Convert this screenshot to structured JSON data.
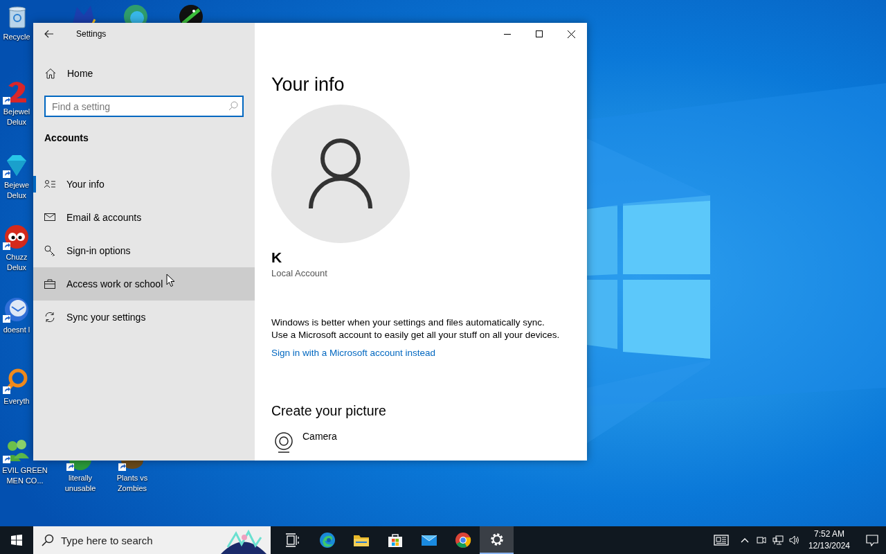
{
  "desktop": {
    "icons": [
      {
        "kind": "recycle",
        "shortcut": false,
        "label": [
          "Recycle"
        ]
      },
      {
        "kind": "badge",
        "shortcut": false
      },
      {
        "kind": "browser",
        "shortcut": false
      },
      {
        "kind": "space",
        "shortcut": false
      },
      {
        "kind": "game",
        "shortcut": true,
        "label": [
          "Bejewel",
          "Delux"
        ]
      },
      {
        "kind": "gem",
        "shortcut": true,
        "label": [
          "Bejewe",
          "Delux"
        ]
      },
      {
        "kind": "creature",
        "shortcut": true,
        "label": [
          "Chuzz",
          "Delux"
        ]
      },
      {
        "kind": "mail",
        "shortcut": true,
        "label": [
          "doesnt l"
        ]
      },
      {
        "kind": "magnifier",
        "shortcut": true,
        "label": [
          "Everyth"
        ]
      },
      {
        "kind": "people",
        "shortcut": true,
        "label": [
          "EVIL GREEN",
          "MEN CO..."
        ]
      },
      {
        "kind": "pie",
        "shortcut": true,
        "label": [
          "literally",
          "unusable"
        ]
      },
      {
        "kind": "plant",
        "shortcut": true,
        "label": [
          "Plants vs",
          "Zombies"
        ]
      }
    ]
  },
  "window": {
    "title": "Settings",
    "sidebar": {
      "home": "Home",
      "search": {
        "placeholder": "Find a setting"
      },
      "section": "Accounts",
      "items": [
        {
          "kind": "info",
          "label": "Your info",
          "selected": true,
          "hovered": false
        },
        {
          "kind": "email",
          "label": "Email & accounts",
          "selected": false,
          "hovered": false
        },
        {
          "kind": "key",
          "label": "Sign-in options",
          "selected": false,
          "hovered": false
        },
        {
          "kind": "work",
          "label": "Access work or school",
          "selected": false,
          "hovered": true
        },
        {
          "kind": "sync",
          "label": "Sync your settings",
          "selected": false,
          "hovered": false
        }
      ]
    },
    "main": {
      "heading": "Your info",
      "user_name": "K",
      "account_type": "Local Account",
      "notice": [
        "Windows is better when your settings and files automatically sync.",
        "Use a Microsoft account to easily get all your stuff on all your devices."
      ],
      "link": "Sign in with a Microsoft account instead",
      "picture_heading": "Create your picture",
      "picture_options": [
        {
          "kind": "camera",
          "label": "Camera"
        }
      ]
    }
  },
  "taskbar": {
    "search": {
      "placeholder": "Type here to search"
    },
    "apps": [
      {
        "kind": "taskview",
        "active": false
      },
      {
        "kind": "edge",
        "active": false
      },
      {
        "kind": "explorer",
        "active": false
      },
      {
        "kind": "store",
        "active": false
      },
      {
        "kind": "mail",
        "active": false
      },
      {
        "kind": "chrome",
        "active": false
      },
      {
        "kind": "settings",
        "active": true
      }
    ],
    "time": "7:52 AM",
    "date": "12/13/2024"
  }
}
